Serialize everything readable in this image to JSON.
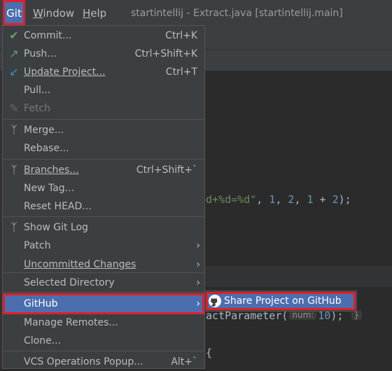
{
  "menubar": {
    "items": [
      {
        "label": "Git"
      },
      {
        "label": "Window"
      },
      {
        "label": "Help"
      }
    ],
    "window_title": "startintellij - Extract.java [startintellij.main]"
  },
  "editor": {
    "line1": {
      "str": "d+%d=%d\"",
      "sep1": ", ",
      "n1": "1",
      "sep2": ", ",
      "n2": "2",
      "sep3": ", ",
      "n3": "1",
      "op": " + ",
      "n4": "2",
      "end": ");"
    },
    "line2": {
      "pre": "actParameter(",
      "hint_label": "num:",
      "val": "10",
      "post": ");",
      "brace": "}"
    },
    "line3": "{"
  },
  "git_menu": {
    "items": [
      {
        "label": "Commit...",
        "shortcut": "Ctrl+K",
        "icon": "check-icon",
        "icon_color": "#59a869"
      },
      {
        "label": "Push...",
        "shortcut": "Ctrl+Shift+K",
        "icon": "push-arrow-icon",
        "icon_color": "#59a869"
      },
      {
        "label": "Update Project...",
        "shortcut": "Ctrl+T",
        "icon": "update-arrow-icon",
        "icon_color": "#3592c4"
      },
      {
        "label": "Pull...",
        "shortcut": ""
      },
      {
        "label": "Fetch",
        "shortcut": "",
        "icon": "fetch-icon",
        "disabled": true
      },
      {
        "label": "Merge...",
        "shortcut": "",
        "icon": "merge-icon"
      },
      {
        "label": "Rebase...",
        "shortcut": ""
      },
      {
        "label": "Branches...",
        "shortcut": "Ctrl+Shift+`",
        "icon": "branch-icon"
      },
      {
        "label": "New Tag...",
        "shortcut": ""
      },
      {
        "label": "Reset HEAD...",
        "shortcut": ""
      },
      {
        "label": "Show Git Log",
        "shortcut": "",
        "icon": "git-log-icon"
      },
      {
        "label": "Patch",
        "submenu": true
      },
      {
        "label": "Uncommitted Changes",
        "submenu": true
      },
      {
        "label": "Selected Directory",
        "submenu": true
      },
      {
        "label": "GitHub",
        "submenu": true,
        "highlighted": true
      },
      {
        "label": "Manage Remotes...",
        "shortcut": ""
      },
      {
        "label": "Clone...",
        "shortcut": ""
      },
      {
        "label": "VCS Operations Popup...",
        "shortcut": "Alt+`"
      }
    ]
  },
  "github_submenu": {
    "items": [
      {
        "label": "Share Project on GitHub",
        "icon": "github-icon"
      }
    ]
  },
  "colors": {
    "highlight": "#4b6eaf",
    "annotation_border": "#e0202a"
  }
}
